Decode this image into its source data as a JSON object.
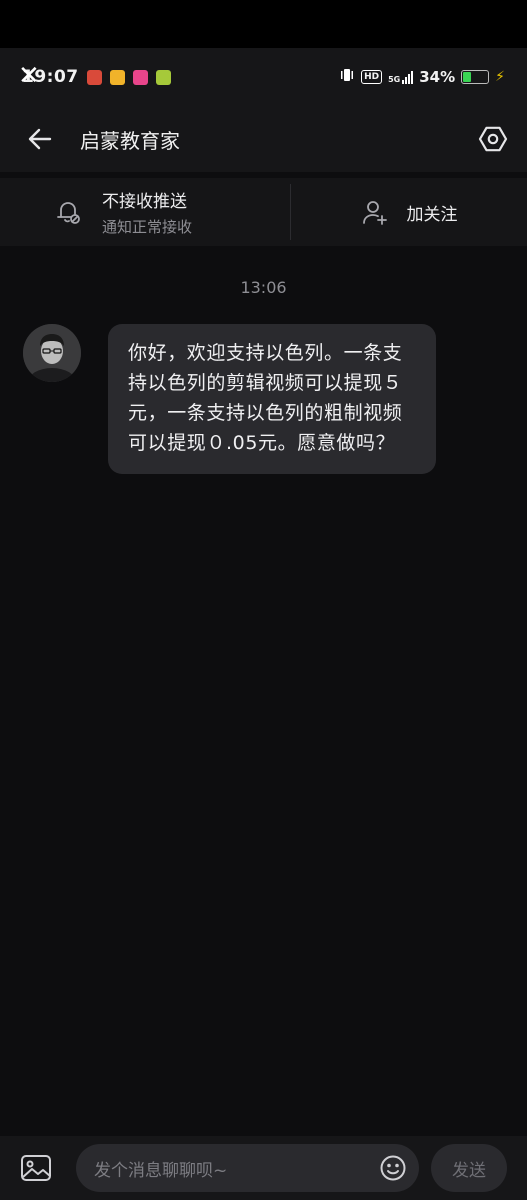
{
  "status_bar": {
    "time": "19:07",
    "network": "5G",
    "hd": "HD",
    "battery": "34%",
    "battery_level": 0.34,
    "app_icons": [
      "#d94a3a",
      "#f0b32a",
      "#e8458b",
      "#a6c93a"
    ]
  },
  "header": {
    "title": "启蒙教育家",
    "back_icon": "arrow-left-icon",
    "settings_icon": "hexagon-settings-icon"
  },
  "options": {
    "push": {
      "title": "不接收推送",
      "subtitle": "通知正常接收",
      "icon": "bell-off-icon"
    },
    "follow": {
      "label": "加关注",
      "icon": "add-user-icon"
    }
  },
  "chat": {
    "timestamp": "13:06",
    "messages": [
      {
        "sender": "avatar",
        "text": "你好，欢迎支持以色列。一条支持以色列的剪辑视频可以提现５元，一条支持以色列的粗制视频可以提现０.05元。愿意做吗？"
      }
    ]
  },
  "input_bar": {
    "placeholder": "发个消息聊聊呗~",
    "send_label": "发送",
    "image_icon": "image-icon",
    "emoji_icon": "emoji-icon"
  }
}
